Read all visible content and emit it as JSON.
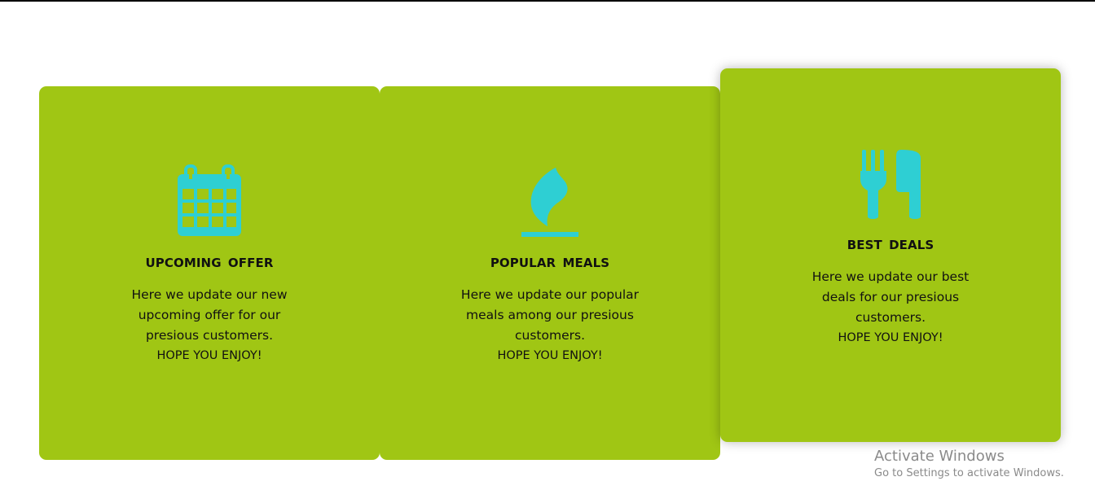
{
  "cards": [
    {
      "title": "UPCOMING  OFFER",
      "body": "Here we update our new upcoming offer for our presious customers.",
      "enjoy": "HOPE YOU ENJOY!",
      "icon": "calendar-icon"
    },
    {
      "title": "POPULAR  MEALS",
      "body": "Here we update our popular meals among our presious customers.",
      "enjoy": "HOPE YOU ENJOY!",
      "icon": "flame-icon"
    },
    {
      "title": "BEST  DEALS",
      "body": "Here we update our best deals for our presious customers.",
      "enjoy": "HOPE YOU ENJOY!",
      "icon": "fork-knife-icon"
    }
  ],
  "watermark": {
    "title": "Activate Windows",
    "subtitle": "Go to Settings to activate Windows."
  },
  "colors": {
    "card_bg": "#a0c614",
    "icon": "#2ecfd3",
    "text": "#111111"
  }
}
